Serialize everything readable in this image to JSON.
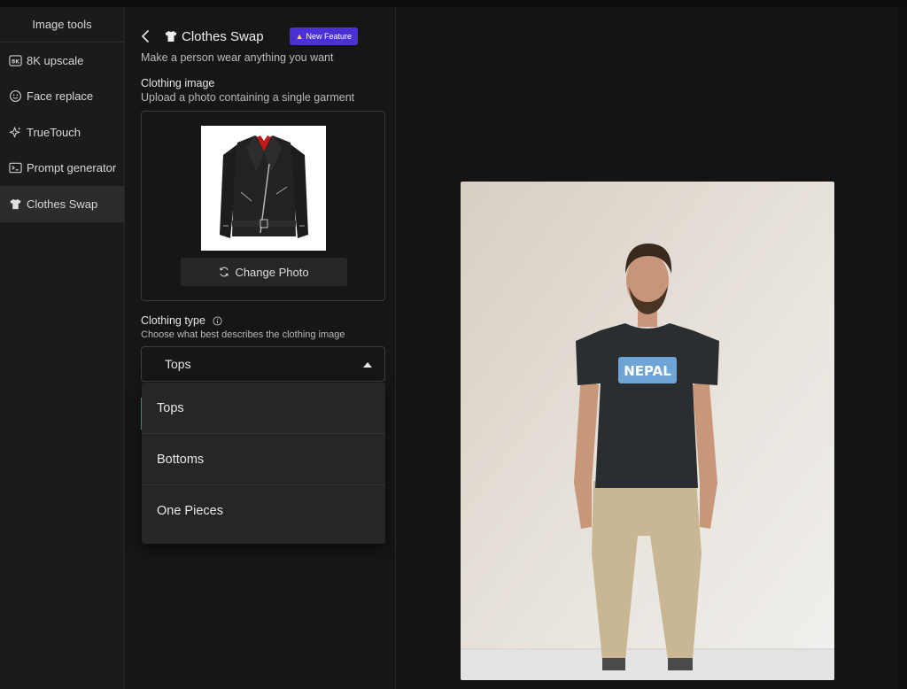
{
  "sidebar": {
    "title": "Image tools",
    "items": [
      {
        "label": "8K upscale",
        "icon": "8k-icon"
      },
      {
        "label": "Face replace",
        "icon": "smiley-icon"
      },
      {
        "label": "TrueTouch",
        "icon": "sparkle-icon"
      },
      {
        "label": "Prompt generator",
        "icon": "terminal-icon"
      },
      {
        "label": "Clothes Swap",
        "icon": "shirt-icon",
        "active": true
      }
    ]
  },
  "panel": {
    "title": "Clothes Swap",
    "badge": "New Feature",
    "subtitle": "Make a person wear anything you want",
    "clothing_image": {
      "label": "Clothing image",
      "help": "Upload a photo containing a single garment",
      "change_button": "Change Photo"
    },
    "clothing_type": {
      "label": "Clothing type",
      "help": "Choose what best describes the clothing image",
      "selected": "Tops",
      "options": [
        "Tops",
        "Bottoms",
        "One Pieces"
      ]
    }
  },
  "colors": {
    "badge": "#4b30d6",
    "focus_border": "#3cc28e",
    "active_item": "#2b2c2c"
  }
}
